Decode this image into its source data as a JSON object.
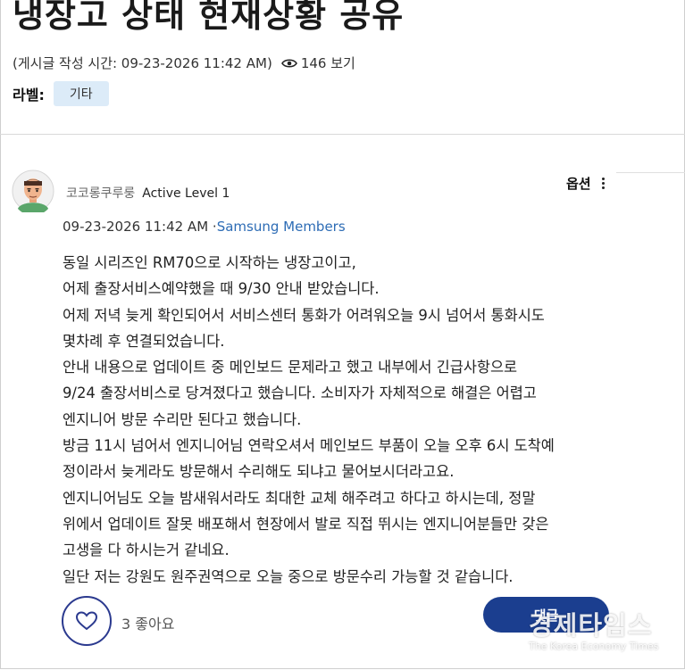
{
  "post": {
    "title": "냉장고 상태 현재상황 공유",
    "written_time": "(게시글 작성 시간: 09-23-2026 11:42 AM)",
    "views": "146 보기",
    "label_title": "라벨:",
    "label_tag": "기타"
  },
  "reply": {
    "author_name": "코코롱쿠루룽",
    "author_level": "Active Level 1",
    "options_label": "옵션",
    "date": "09-23-2026 11:42 AM",
    "separator": "·",
    "source": "Samsung Members",
    "body_lines": [
      "동일 시리즈인 RM70으로 시작하는 냉장고이고,",
      "어제 출장서비스예약했을 때 9/30 안내 받았습니다.",
      "어제 저녁 늦게 확인되어서 서비스센터 통화가 어려워오늘 9시 넘어서 통화시도",
      "몇차례 후 연결되었습니다.",
      "안내 내용으로 업데이트 중 메인보드 문제라고 했고 내부에서 긴급사항으로",
      "9/24 출장서비스로 당겨졌다고 했습니다. 소비자가 자체적으로 해결은 어렵고",
      "엔지니어 방문 수리만 된다고 했습니다.",
      "방금 11시 넘어서 엔지니어님 연락오셔서 메인보드 부품이 오늘 오후 6시 도착예",
      "정이라서 늦게라도 방문해서 수리해도 되냐고 물어보시더라고요.",
      "엔지니어님도 오늘 밤새워서라도 최대한 교체 해주려고 하다고 하시는데, 정말",
      "위에서 업데이트 잘못 배포해서 현장에서 발로 직접 뛰시는 엔지니어분들만 갖은",
      "고생을 다 하시는거 같네요.",
      "일단 저는 강원도 원주권역으로 오늘 중으로 방문수리 가능할 것 같습니다."
    ],
    "likes": "3 좋아요",
    "reply_button": "댓글"
  },
  "watermark": {
    "main": "경제타임스",
    "sub": "The Korea Economy Times"
  },
  "icons": {
    "views": "eye-icon",
    "like": "heart-icon",
    "options": "kebab-menu-icon",
    "avatar": "user-avatar"
  },
  "colors": {
    "link": "#2d6cb5",
    "primary_button": "#1b3e8f",
    "label_tag_bg": "#dcebf8"
  }
}
